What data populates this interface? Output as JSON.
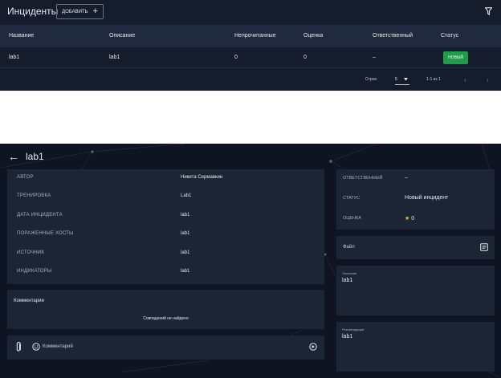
{
  "incidents_panel": {
    "title": "Инциденты",
    "add_button": {
      "label": "ДОБАВИТЬ",
      "icon": "plus-icon"
    },
    "filter_icon": "filter-icon",
    "columns": [
      "Название",
      "Описание",
      "Непрочитанные",
      "Оценка",
      "Ответственный",
      "Статус"
    ],
    "rows": [
      {
        "name": "lab1",
        "description": "lab1",
        "unread": "0",
        "score": "0",
        "assignee": "–",
        "status": "НОВЫЙ"
      }
    ],
    "pagination": {
      "rows_label": "Строк:",
      "rows_per_page": "5",
      "range": "1-1 из 1"
    },
    "colors": {
      "bg": "#151d2c",
      "header": "#1f2a3e",
      "status_new": "#1e9b4b"
    }
  },
  "incident_detail": {
    "back_icon": "arrow-left-icon",
    "title": "lab1",
    "fields": [
      {
        "label": "АВТОР",
        "value": "Никита Сермавкин"
      },
      {
        "label": "ТРЕНИРОВКА",
        "value": "Lab1"
      },
      {
        "label": "ДАТА ИНЦИДЕНТА",
        "value": "lab1"
      },
      {
        "label": "ПОРАЖЕННЫЕ ХОСТЫ",
        "value": "lab1"
      },
      {
        "label": "ИСТОЧНИК",
        "value": "lab1"
      },
      {
        "label": "ИНДИКАТОРЫ",
        "value": "lab1"
      }
    ],
    "comments": {
      "title": "Комментарии",
      "empty": "Совпадений не найдено"
    },
    "composer": {
      "placeholder": "Комментарий",
      "attach_icon": "paperclip-icon",
      "emoji_icon": "smile-icon",
      "send_icon": "send-icon"
    },
    "side": [
      {
        "label": "ОТВЕТСТВЕННЫЙ",
        "value": "–"
      },
      {
        "label": "СТАТУС",
        "value": "Новый инцидент"
      },
      {
        "label": "ОЦЕНКА",
        "value": "0",
        "icon": "star-icon"
      }
    ],
    "file": {
      "label": "Файл",
      "icon": "document-icon"
    },
    "description": {
      "label": "Описание",
      "value": "lab1"
    },
    "recommendations": {
      "label": "Рекомендации",
      "value": "lab1"
    },
    "colors": {
      "bg": "#0f1422",
      "card": "#1b2536",
      "star": "#f2c230"
    }
  }
}
